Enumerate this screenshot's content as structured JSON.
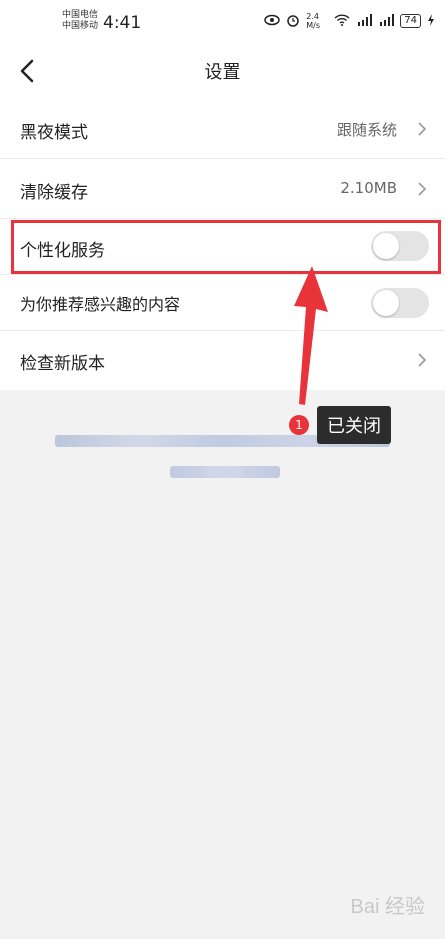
{
  "status": {
    "carrier1": "中国电信",
    "carrier2": "中国移动",
    "time": "4:41",
    "speed": "2.4 M/s",
    "battery": "74"
  },
  "header": {
    "title": "设置"
  },
  "settings": {
    "dark_mode": {
      "label": "黑夜模式",
      "value": "跟随系统"
    },
    "clear_cache": {
      "label": "清除缓存",
      "value": "2.10MB"
    },
    "personalized": {
      "label": "个性化服务",
      "enabled": false
    },
    "recommend": {
      "label": "为你推荐感兴趣的内容",
      "enabled": false
    },
    "check_update": {
      "label": "检查新版本"
    }
  },
  "annotation": {
    "badge": "1",
    "tooltip": "已关闭"
  },
  "watermark": "Bai 经验",
  "colors": {
    "highlight": "#e8333a",
    "tooltip_bg": "#2c2c2c",
    "toggle_off": "#e4e4e4"
  }
}
